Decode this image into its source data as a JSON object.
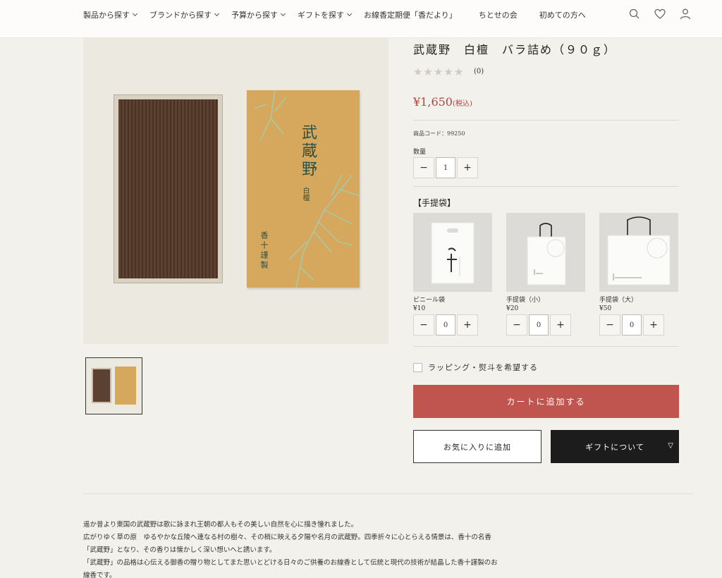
{
  "nav": {
    "items": [
      {
        "label": "製品から探す",
        "has_dropdown": true
      },
      {
        "label": "ブランドから探す",
        "has_dropdown": true
      },
      {
        "label": "予算から探す",
        "has_dropdown": true
      },
      {
        "label": "ギフトを探す",
        "has_dropdown": true
      },
      {
        "label": "お線香定期便「香だより」",
        "has_dropdown": false
      },
      {
        "label": "ちとせの会",
        "has_dropdown": false
      },
      {
        "label": "初めての方へ",
        "has_dropdown": false
      }
    ],
    "icons": [
      "search-icon",
      "heart-icon",
      "user-icon"
    ]
  },
  "product": {
    "title": "武蔵野　白檀　バラ詰め（９０ｇ）",
    "rating_count": "(0)",
    "rating_value": 0,
    "price": "¥1,650",
    "price_tax": "(税込)",
    "code": "商品コード：99250",
    "qty_label": "数量",
    "qty": {
      "minus": "−",
      "value": "1",
      "plus": "+"
    },
    "image_text": {
      "main": "武蔵野",
      "sub": "白檀",
      "maker": "香十謹製"
    }
  },
  "bags": {
    "heading": "【手提袋】",
    "items": [
      {
        "name": "ビニール袋",
        "price": "¥10",
        "qty": "0"
      },
      {
        "name": "手提袋（小）",
        "price": "¥20",
        "qty": "0"
      },
      {
        "name": "手提袋（大）",
        "price": "¥50",
        "qty": "0"
      }
    ],
    "minus": "−",
    "plus": "+"
  },
  "wrapping": {
    "label": "ラッピング・熨斗を希望する",
    "checked": false
  },
  "actions": {
    "cart": "カートに追加する",
    "favorite": "お気に入りに追加",
    "gift": "ギフトについて",
    "gift_marker": "▽"
  },
  "description": [
    "遥か昔より東国の武蔵野は歌に詠まれ王朝の都人もその美しい自然を心に描き憧れました。",
    "広がりゆく草の原　ゆるやかな丘陵へ連なる村の樹々、その梢に映える夕陽や名月の武蔵野。四季折々に心とらえる情景は、香十の名香「武蔵野」となり、その香りは懐かしく深い想いへと誘います。",
    "「武蔵野」の品格は心伝える御香の贈り物としてまた思いとどける日々のご供養のお線香として伝統と現代の技術が結晶した香十謹製のお線香です。"
  ],
  "colors": {
    "accent": "#c0544f",
    "price": "#b8423d",
    "dark": "#1c1c1c",
    "background": "#f3f1ec"
  }
}
